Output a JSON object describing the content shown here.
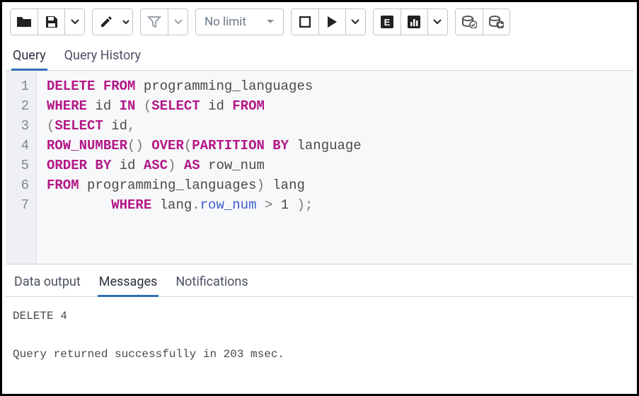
{
  "toolbar": {
    "limit_label": "No limit"
  },
  "tabs": {
    "query": "Query",
    "history": "Query History"
  },
  "editor": {
    "line_numbers": [
      "1",
      "2",
      "3",
      "4",
      "5",
      "6",
      "7"
    ],
    "lines": [
      {
        "raw": "DELETE FROM programming_languages"
      },
      {
        "raw": "WHERE id IN (SELECT id FROM"
      },
      {
        "raw": "(SELECT id,"
      },
      {
        "raw": "ROW_NUMBER() OVER(PARTITION BY language"
      },
      {
        "raw": "ORDER BY id ASC) AS row_num"
      },
      {
        "raw": "FROM programming_languages) lang"
      },
      {
        "raw": "        WHERE lang.row_num > 1 );"
      }
    ]
  },
  "bottom_tabs": {
    "data_output": "Data output",
    "messages": "Messages",
    "notifications": "Notifications"
  },
  "messages": {
    "line1": "DELETE 4",
    "line2": "Query returned successfully in 203 msec."
  }
}
